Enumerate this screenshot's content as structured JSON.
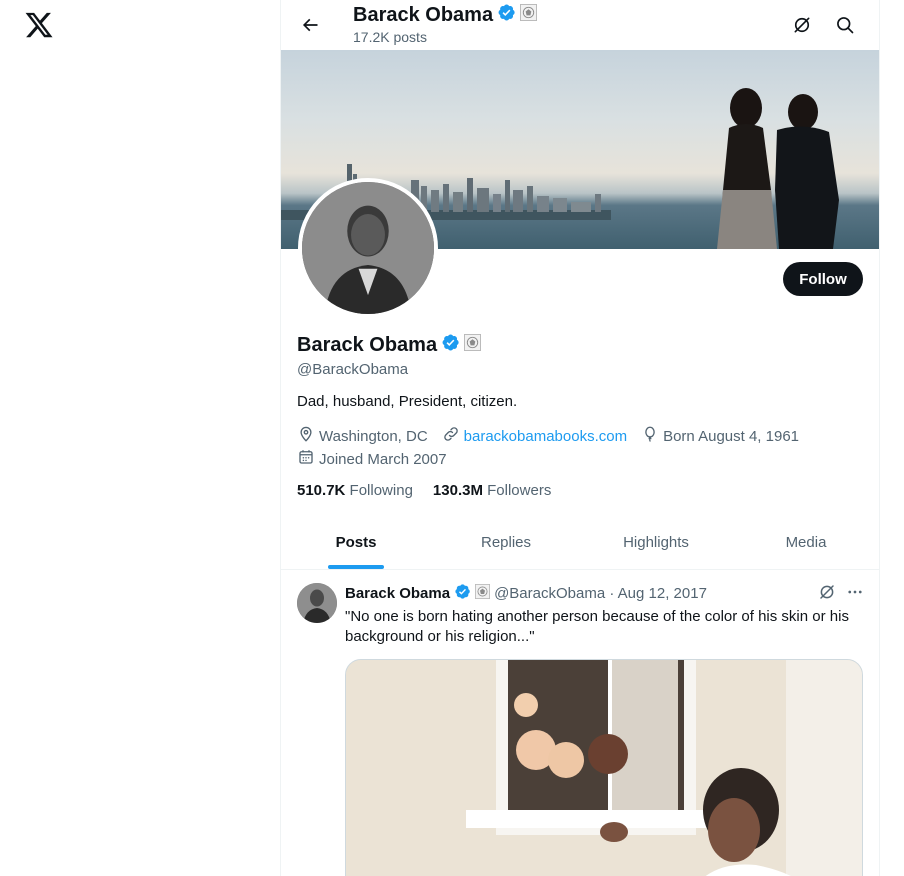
{
  "app": {
    "logo_icon": "x-logo-icon"
  },
  "header": {
    "name": "Barack Obama",
    "post_count": "17.2K posts",
    "back_icon": "arrow-left-icon",
    "grok_icon": "grok-icon",
    "search_icon": "search-icon"
  },
  "profile": {
    "name": "Barack Obama",
    "handle": "@BarackObama",
    "bio": "Dad, husband, President, citizen.",
    "location": "Washington, DC",
    "website": "barackobamabooks.com",
    "born": "Born August 4, 1961",
    "joined": "Joined March 2007",
    "following_count": "510.7K",
    "following_label": "Following",
    "followers_count": "130.3M",
    "followers_label": "Followers",
    "follow_button": "Follow"
  },
  "tabs": [
    {
      "label": "Posts",
      "active": true
    },
    {
      "label": "Replies",
      "active": false
    },
    {
      "label": "Highlights",
      "active": false
    },
    {
      "label": "Media",
      "active": false
    }
  ],
  "tweet": {
    "name": "Barack Obama",
    "meta": "@BarackObama · Aug 12, 2017",
    "text": "\"No one is born hating another person because of the color of his skin or his background or his religion...\""
  },
  "colors": {
    "accent": "#1d9bf0",
    "text": "#0f1419",
    "secondary": "#536471",
    "button": "#0f1419"
  }
}
